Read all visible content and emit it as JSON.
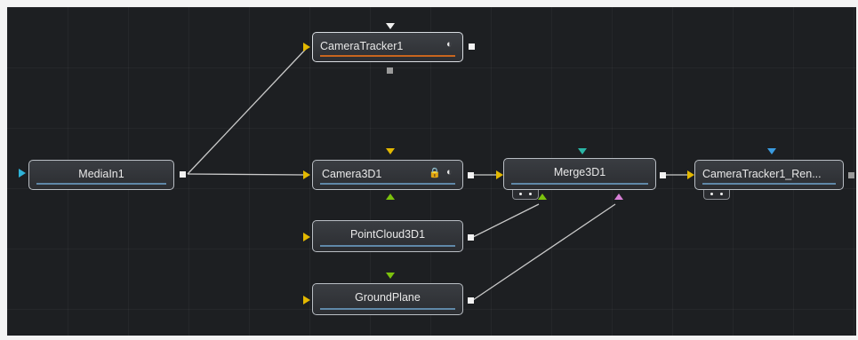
{
  "colors": {
    "background": "#1d1f22",
    "node_border": "#b9bec4",
    "node_fill": "#2b2d31",
    "wire": "#c9c9c9",
    "input_yellow": "#e3b800",
    "input_green": "#7cc20d",
    "input_pink": "#d87fd6",
    "input_cyan": "#2fb3d8",
    "tracker_bar": "#c8651e",
    "node_bar": "#5f88a8"
  },
  "nodes": {
    "media_in": {
      "label": "MediaIn1"
    },
    "camera_tracker": {
      "label": "CameraTracker1",
      "icons": [
        "half-circle-icon"
      ]
    },
    "camera3d": {
      "label": "Camera3D1",
      "icons": [
        "lock-icon",
        "half-circle-icon"
      ]
    },
    "merge3d": {
      "label": "Merge3D1"
    },
    "camera_tracker_render": {
      "label": "CameraTracker1_Ren..."
    },
    "point_cloud": {
      "label": "PointCloud3D1"
    },
    "ground_plane": {
      "label": "GroundPlane"
    }
  },
  "icon_glyphs": {
    "lock": "🔒",
    "half_circle": "◐"
  }
}
